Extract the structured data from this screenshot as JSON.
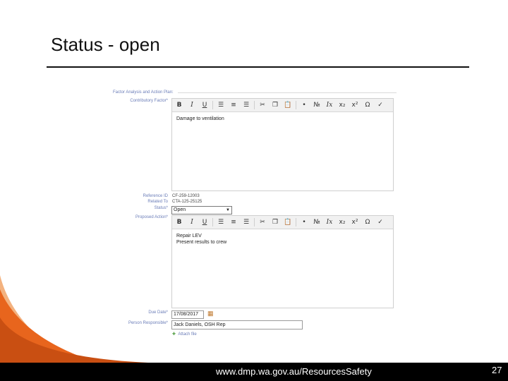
{
  "slide": {
    "title": "Status - open",
    "footer_url": "www.dmp.wa.gov.au/ResourcesSafety",
    "page_number": "27"
  },
  "form": {
    "section_heading": "Factor Analysis and Action Plan:",
    "contributory_factor_label": "Contributory Factor*",
    "contributory_factor_text": "Damage to ventilation",
    "reference_id_label": "Reference ID",
    "reference_id_value": "CF-259-12003",
    "related_to_label": "Related To",
    "related_to_value": "CTA-125-25125",
    "status_label": "Status*",
    "status_value": "Open",
    "proposed_action_label": "Proposed Action*",
    "proposed_action_lines": [
      "Repair LEV",
      "Present results to crew"
    ],
    "due_date_label": "Due Date*",
    "due_date_value": "17/08/2017",
    "person_responsible_label": "Person Responsible*",
    "person_responsible_value": "Jack Daniels, OSH Rep",
    "attach_label": "Attach file"
  },
  "toolbar_icons": [
    "bold-icon",
    "italic-icon",
    "underline-icon",
    "align-left-icon",
    "align-center-icon",
    "align-right-icon",
    "cut-icon",
    "copy-icon",
    "paste-icon",
    "bulleted-list-icon",
    "numbered-list-icon",
    "clear-format-icon",
    "subscript-icon",
    "superscript-icon",
    "special-char-icon",
    "spellcheck-icon"
  ],
  "colors": {
    "accent_orange": "#e8651d",
    "label_blue": "#6b7db8",
    "footer_bg": "#000000"
  }
}
